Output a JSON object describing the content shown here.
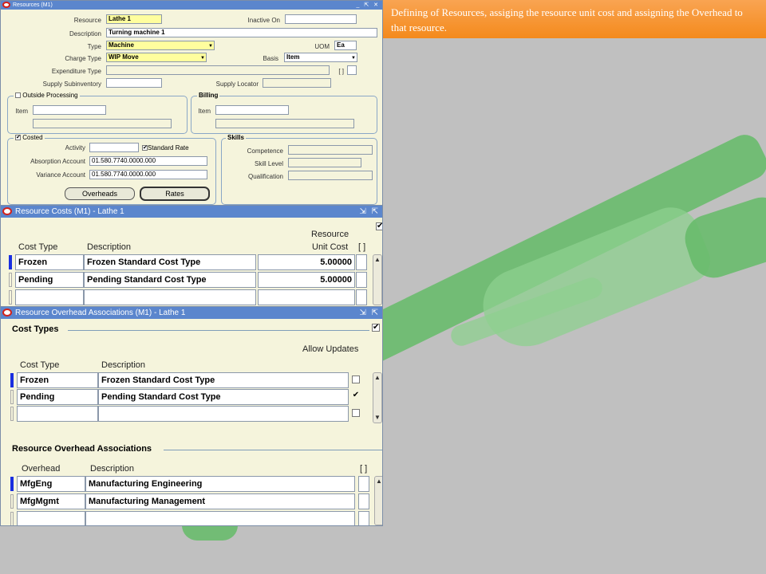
{
  "banner": {
    "text": "Defining of Resources, assiging the resource unit cost and assigning the Overhead to that resource."
  },
  "resources": {
    "title": "Resources (M1)",
    "labels": {
      "resource": "Resource",
      "inactive_on": "Inactive On",
      "description": "Description",
      "type": "Type",
      "uom": "UOM",
      "charge_type": "Charge Type",
      "basis": "Basis",
      "expenditure_type": "Expenditure Type",
      "supply_subinventory": "Supply Subinventory",
      "supply_locator": "Supply Locator",
      "outside_processing": "Outside Processing",
      "item": "Item",
      "billing": "Billing",
      "billing_item": "Item",
      "costed": "Costed",
      "activity": "Activity",
      "standard_rate": "Standard Rate",
      "absorption_account": "Absorption Account",
      "variance_account": "Variance Account",
      "skills": "Skills",
      "competence": "Competence",
      "skill_level": "Skill Level",
      "qualification": "Qualification",
      "bracket": "[ ]"
    },
    "values": {
      "resource": "Lathe 1",
      "inactive_on": "",
      "description": "Turning machine 1",
      "type": "Machine",
      "uom": "Ea",
      "charge_type": "WIP Move",
      "basis": "Item",
      "expenditure_type": "",
      "supply_subinventory": "",
      "supply_locator": "",
      "op_item": "",
      "billing_item": "",
      "activity": "",
      "absorption_account": "01.580.7740.0000.000",
      "variance_account": "01.580.7740.0000.000",
      "competence": "",
      "skill_level": "",
      "qualification": ""
    },
    "costed_checked": true,
    "standard_rate_checked": true,
    "buttons": {
      "overheads": "Overheads",
      "rates": "Rates"
    }
  },
  "resource_costs": {
    "title": "Resource Costs (M1) - Lathe 1",
    "headers": {
      "cost_type": "Cost Type",
      "description": "Description",
      "unit_cost_1": "Resource",
      "unit_cost_2": "Unit Cost",
      "bracket": "[ ]"
    },
    "rows": [
      {
        "cost_type": "Frozen",
        "description": "Frozen Standard Cost Type",
        "unit_cost": "5.00000"
      },
      {
        "cost_type": "Pending",
        "description": "Pending Standard Cost Type",
        "unit_cost": "5.00000"
      }
    ]
  },
  "overhead_assoc": {
    "title": "Resource Overhead Associations (M1) - Lathe 1",
    "cost_types_section": "Cost Types",
    "headers": {
      "cost_type": "Cost Type",
      "description": "Description",
      "allow_updates": "Allow Updates"
    },
    "rows": [
      {
        "cost_type": "Frozen",
        "description": "Frozen Standard Cost Type",
        "allow_updates": false
      },
      {
        "cost_type": "Pending",
        "description": "Pending Standard Cost Type",
        "allow_updates": true
      }
    ],
    "assoc_section": "Resource Overhead Associations",
    "assoc_headers": {
      "overhead": "Overhead",
      "description": "Description",
      "bracket": "[ ]"
    },
    "assoc_rows": [
      {
        "overhead": "MfgEng",
        "description": "Manufacturing Engineering"
      },
      {
        "overhead": "MfgMgmt",
        "description": "Manufacturing Management"
      }
    ]
  },
  "colors": {
    "titlebar": "#5b86cd",
    "window_bg": "#f5f4dc",
    "required_field": "#fffe9e",
    "banner": "#f48a1c",
    "hand": "#66bb6a"
  },
  "icons": [
    "oracle-logo-icon",
    "minimize-icon",
    "maximize-icon",
    "close-icon",
    "dropdown-arrow-icon",
    "scroll-up-icon",
    "scroll-down-icon",
    "checkmark-icon"
  ]
}
